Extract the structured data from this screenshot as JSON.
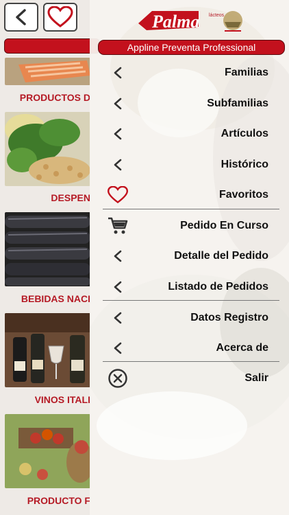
{
  "brand": {
    "name": "Palma",
    "tag": "lácteos"
  },
  "header": {
    "app_title": "Appline Preventa Professional"
  },
  "categories": [
    {
      "label": "PRODUCTOS D"
    },
    {
      "label": "DESPEN"
    },
    {
      "label": "BEBIDAS NACI"
    },
    {
      "label": "VINOS ITALI"
    },
    {
      "label": "PRODUCTO F"
    }
  ],
  "menu": [
    {
      "label": "Familias",
      "icon": "chevron-left-icon"
    },
    {
      "label": "Subfamilias",
      "icon": "chevron-left-icon"
    },
    {
      "label": "Artículos",
      "icon": "chevron-left-icon"
    },
    {
      "label": "Histórico",
      "icon": "chevron-left-icon"
    },
    {
      "label": "Favoritos",
      "icon": "heart-icon"
    },
    {
      "label": "Pedido En Curso",
      "icon": "cart-icon"
    },
    {
      "label": "Detalle del Pedido",
      "icon": "chevron-left-icon"
    },
    {
      "label": "Listado de Pedidos",
      "icon": "chevron-left-icon"
    },
    {
      "label": "Datos Registro",
      "icon": "chevron-left-icon"
    },
    {
      "label": "Acerca de",
      "icon": "chevron-left-icon"
    },
    {
      "label": "Salir",
      "icon": "close-circle-icon"
    }
  ],
  "colors": {
    "accent": "#c3111d",
    "label_red": "#b51a25"
  }
}
